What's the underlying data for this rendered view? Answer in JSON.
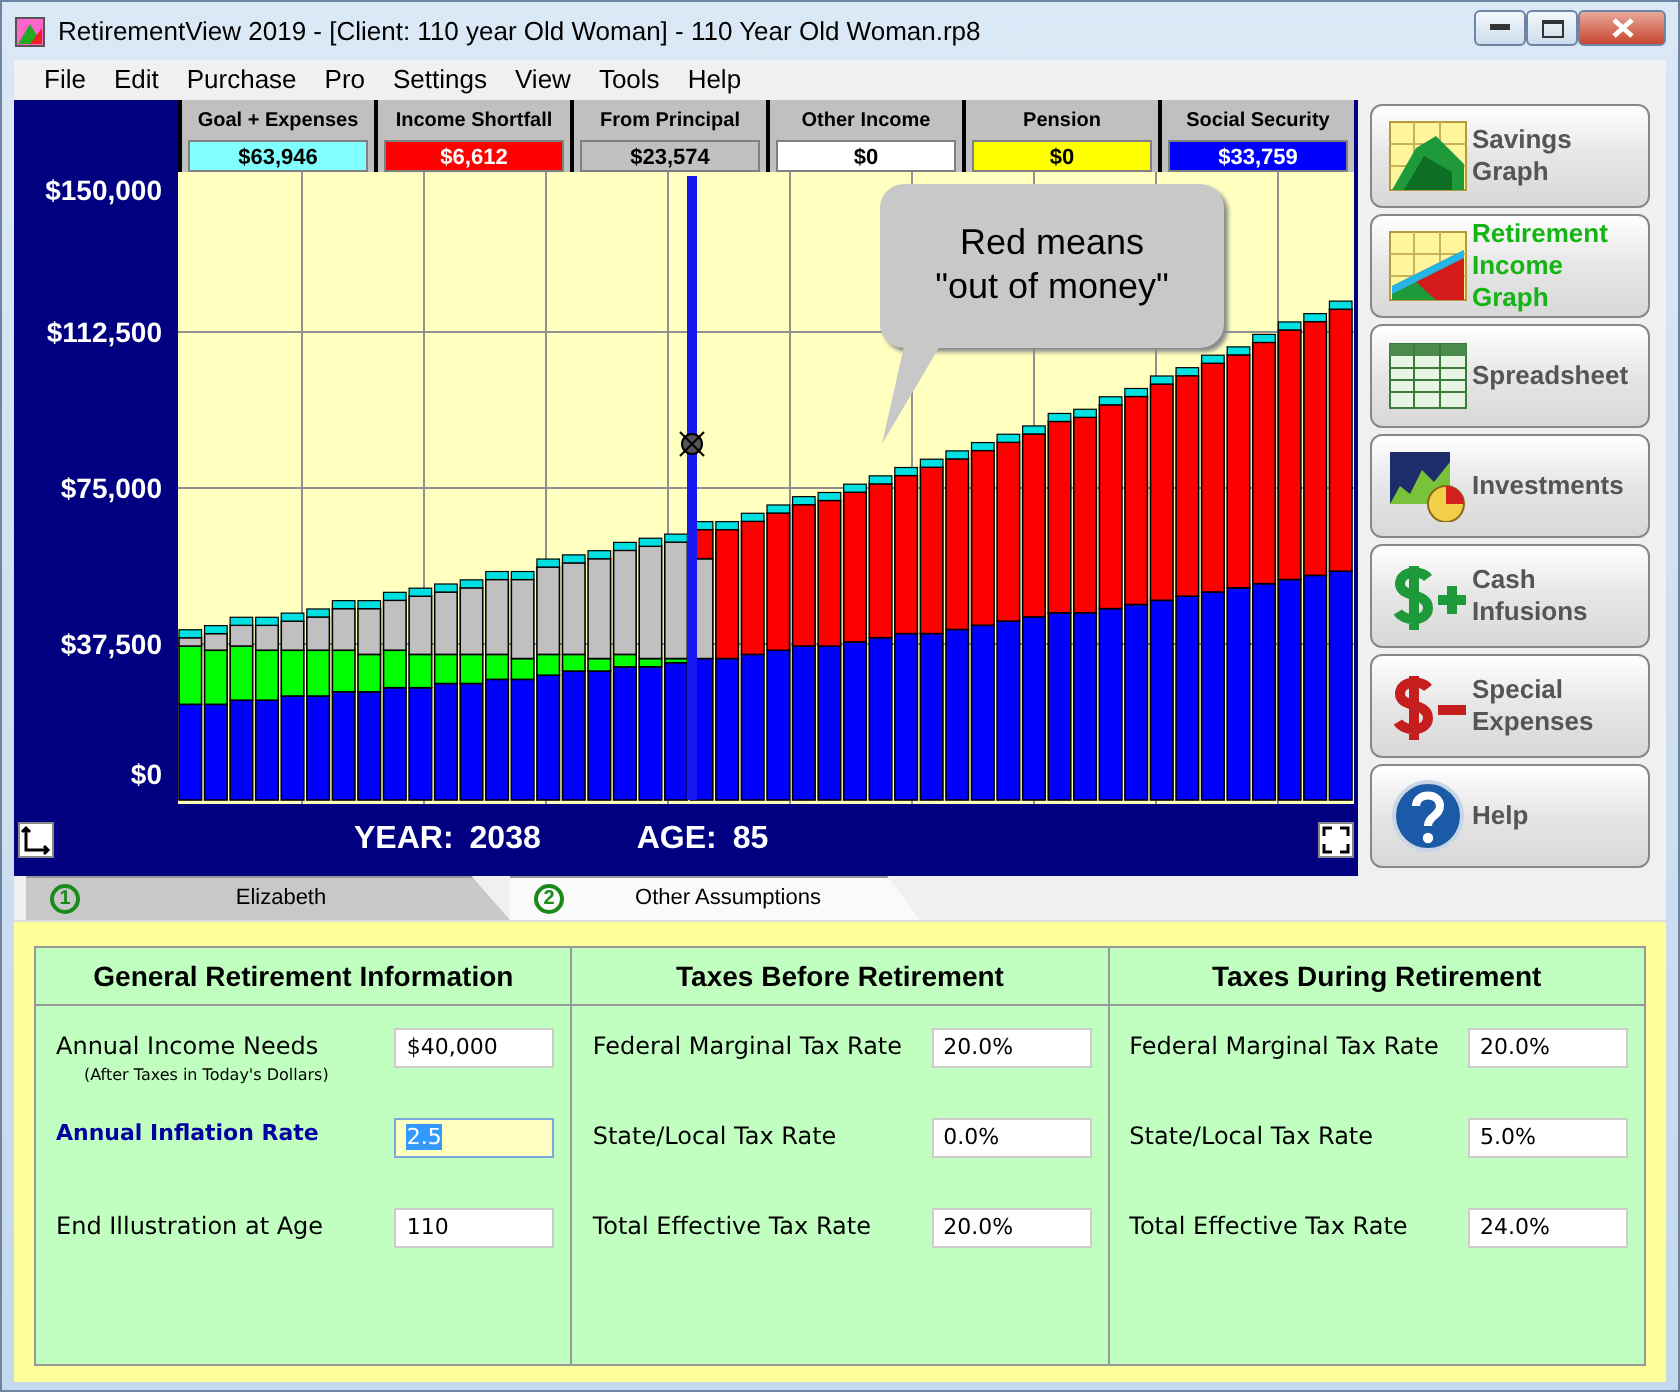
{
  "window": {
    "title": "RetirementView 2019 - [Client: 110 year Old Woman] - 110 Year Old Woman.rp8"
  },
  "menu": [
    "File",
    "Edit",
    "Purchase",
    "Pro",
    "Settings",
    "View",
    "Tools",
    "Help"
  ],
  "legend": [
    {
      "label": "Goal + Expenses",
      "value": "$63,946",
      "color": "#80ffff"
    },
    {
      "label": "Income Shortfall",
      "value": "$6,612",
      "color": "#ff0000"
    },
    {
      "label": "From Principal",
      "value": "$23,574",
      "color": "#c0c0c0"
    },
    {
      "label": "Other Income",
      "value": "$0",
      "color": "#ffffff"
    },
    {
      "label": "Pension",
      "value": "$0",
      "color": "#ffff00"
    },
    {
      "label": "Social Security",
      "value": "$33,759",
      "color": "#0000ff"
    }
  ],
  "chart": {
    "chart_data": {
      "type": "bar",
      "stacked": true,
      "grid": true,
      "ylim": [
        0,
        150000
      ],
      "yticks": [
        {
          "value": 0,
          "label": "$0"
        },
        {
          "value": 37500,
          "label": "$37,500"
        },
        {
          "value": 75000,
          "label": "$75,000"
        },
        {
          "value": 112500,
          "label": "$112,500"
        },
        {
          "value": 150000,
          "label": "$150,000"
        }
      ],
      "series": [
        {
          "color": "#0000ff",
          "values": [
            23000,
            23000,
            24000,
            24000,
            25000,
            25000,
            26000,
            26000,
            27000,
            27000,
            28000,
            28000,
            29000,
            29000,
            30000,
            31000,
            31000,
            32000,
            32000,
            33000,
            34000,
            34000,
            35000,
            36000,
            37000,
            37000,
            38000,
            39000,
            40000,
            40000,
            41000,
            42000,
            43000,
            44000,
            45000,
            45000,
            46000,
            47000,
            48000,
            49000,
            50000,
            51000,
            52000,
            53000,
            54000,
            55000
          ]
        },
        {
          "color": "#00ff00",
          "values": [
            14000,
            13000,
            13000,
            12000,
            11000,
            11000,
            10000,
            9000,
            9000,
            8000,
            7000,
            7000,
            6000,
            5000,
            5000,
            4000,
            3000,
            3000,
            2000,
            1000,
            0,
            0,
            0,
            0,
            0,
            0,
            0,
            0,
            0,
            0,
            0,
            0,
            0,
            0,
            0,
            0,
            0,
            0,
            0,
            0,
            0,
            0,
            0,
            0,
            0,
            0
          ]
        },
        {
          "color": "#c0c0c0",
          "values": [
            2000,
            4000,
            5000,
            6000,
            7000,
            8000,
            10000,
            11000,
            12000,
            14000,
            15000,
            16000,
            18000,
            19000,
            21000,
            22000,
            24000,
            25000,
            27000,
            28000,
            24000,
            0,
            0,
            0,
            0,
            0,
            0,
            0,
            0,
            0,
            0,
            0,
            0,
            0,
            0,
            0,
            0,
            0,
            0,
            0,
            0,
            0,
            0,
            0,
            0,
            0
          ]
        },
        {
          "color": "#ff0000",
          "values": [
            0,
            0,
            0,
            0,
            0,
            0,
            0,
            0,
            0,
            0,
            0,
            0,
            0,
            0,
            0,
            0,
            0,
            0,
            0,
            0,
            7000,
            31000,
            32000,
            33000,
            34000,
            35000,
            36000,
            37000,
            38000,
            40000,
            41000,
            42000,
            43000,
            44000,
            46000,
            47000,
            49000,
            50000,
            52000,
            53000,
            55000,
            56000,
            58000,
            60000,
            61000,
            63000
          ]
        }
      ]
    },
    "cursor": true,
    "callout": [
      "Red means",
      "\"out of money\""
    ],
    "year_label": "YEAR:",
    "year": "2038",
    "age_label": "AGE:",
    "age": "85"
  },
  "sidebar": [
    {
      "kind": "savings",
      "label": "Savings Graph",
      "selected": false
    },
    {
      "kind": "income",
      "label": "Retirement Income Graph",
      "selected": true
    },
    {
      "kind": "spreadsheet",
      "label": "Spreadsheet",
      "selected": false
    },
    {
      "kind": "investments",
      "label": "Investments",
      "selected": false
    },
    {
      "kind": "infusions",
      "label": "Cash Infusions",
      "selected": false
    },
    {
      "kind": "expenses",
      "label": "Special Expenses",
      "selected": false
    },
    {
      "kind": "help",
      "label": "Help",
      "selected": false
    }
  ],
  "tabs": [
    {
      "number": "1",
      "label": "Elizabeth",
      "selected": false
    },
    {
      "number": "2",
      "label": "Other Assumptions",
      "selected": true
    }
  ],
  "sections": [
    {
      "title": "General Retirement Information",
      "fields": [
        {
          "label": "Annual Income Needs",
          "note": "(After Taxes in Today's Dollars)",
          "value": "$40,000",
          "focused": false
        },
        {
          "label": "Annual Inflation Rate",
          "value": "2.5",
          "focused": true
        },
        {
          "label": "End Illustration at Age",
          "value": "110",
          "focused": false
        }
      ]
    },
    {
      "title": "Taxes Before Retirement",
      "fields": [
        {
          "label": "Federal Marginal Tax Rate",
          "value": "20.0%",
          "focused": false
        },
        {
          "label": "State/Local Tax Rate",
          "value": "0.0%",
          "focused": false
        },
        {
          "label": "Total Effective Tax Rate",
          "value": "20.0%",
          "focused": false
        }
      ]
    },
    {
      "title": "Taxes During Retirement",
      "fields": [
        {
          "label": "Federal Marginal Tax Rate",
          "value": "20.0%",
          "focused": false
        },
        {
          "label": "State/Local Tax Rate",
          "value": "5.0%",
          "focused": false
        },
        {
          "label": "Total Effective Tax Rate",
          "value": "24.0%",
          "focused": false
        }
      ]
    }
  ]
}
